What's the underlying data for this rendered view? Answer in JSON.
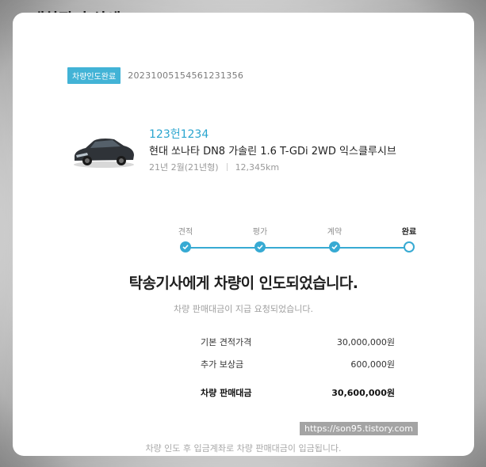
{
  "page": {
    "title": "내차팔기 상세"
  },
  "order": {
    "status": "차량인도완료",
    "number": "20231005154561231356"
  },
  "vehicle": {
    "plate": "123헌1234",
    "model": "현대 쏘나타 DN8 가솔린 1.6 T-GDi 2WD 익스클루시브",
    "year": "21년 2월(21년형)",
    "mileage": "12,345km",
    "image_icon": "car-icon"
  },
  "progress": {
    "steps": [
      {
        "label": "견적",
        "state": "done"
      },
      {
        "label": "평가",
        "state": "done"
      },
      {
        "label": "계약",
        "state": "done"
      },
      {
        "label": "완료",
        "state": "current"
      }
    ],
    "accent": "#37aad3"
  },
  "message": {
    "headline": "탁송기사에게 차량이 인도되었습니다.",
    "sub": "차량 판매대금이 지급 요청되었습니다."
  },
  "prices": [
    {
      "label": "기본 견적가격",
      "value": "30,000,000원"
    },
    {
      "label": "추가 보상금",
      "value": "600,000원"
    },
    {
      "label": "차량 판매대금",
      "value": "30,600,000원"
    }
  ],
  "footer": {
    "note": "차량 인도 후 입금계좌로 차량 판매대금이 입금됩니다."
  },
  "watermark": {
    "text": "https://son95.tistory.com"
  }
}
